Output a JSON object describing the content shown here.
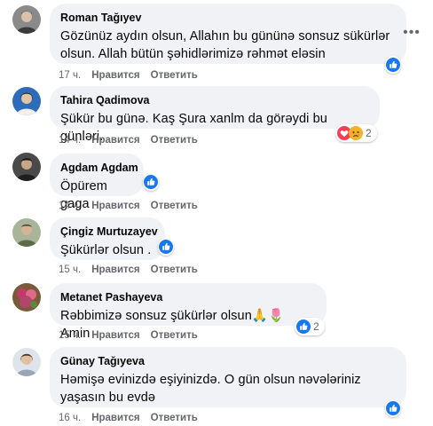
{
  "comments": [
    {
      "author": "Roman Tağıyev",
      "lines": [
        "Gözünüz aydın olsun, Allahın bu gününə sonsuz sükürlər",
        "olsun. Allah bütün şəhidlərimizə rəhmət eləsin"
      ],
      "time": "17 ч.",
      "like_label": "Нравится",
      "reply_label": "Ответить",
      "reactions": [
        "like"
      ],
      "reaction_count": "",
      "avatar_color": "#6b6b6b"
    },
    {
      "author": "Tahira Qadimova",
      "lines": [
        "Şükür bu günə. Kaş Şura xanlm da görəydi bu günləri."
      ],
      "time": "14 ч.",
      "like_label": "Нравится",
      "reply_label": "Ответить",
      "reactions": [
        "love",
        "sad"
      ],
      "reaction_count": "2",
      "avatar_color": "#2d6cb8"
    },
    {
      "author": "Agdam Agdam",
      "lines": [
        "Öpürem gaga"
      ],
      "time": "14 ч.",
      "like_label": "Нравится",
      "reply_label": "Ответить",
      "reactions": [
        "like"
      ],
      "reaction_count": "",
      "avatar_color": "#3b3b3b"
    },
    {
      "author": "Çingiz Murtuzayev",
      "lines": [
        "Şükürlər olsun ."
      ],
      "time": "15 ч.",
      "like_label": "Нравится",
      "reply_label": "Ответить",
      "reactions": [
        "like"
      ],
      "reaction_count": "",
      "avatar_color": "#7a8a6a"
    },
    {
      "author": "Metanet Pashayeva",
      "lines": [
        "Rəbbimizə sonsuz şükürlər olsun🙏🌷 Amin"
      ],
      "time": "15 ч.",
      "like_label": "Нравится",
      "reply_label": "Ответить",
      "reactions": [
        "like"
      ],
      "reaction_count": "2",
      "avatar_color": "#b0466a"
    },
    {
      "author": "Günay Tağıyeva",
      "lines": [
        "Həmişə evinizdə eşiyinizdə. O gün olsun nəvələriniz",
        "yaşasın bu evdə"
      ],
      "time": "16 ч.",
      "like_label": "Нравится",
      "reply_label": "Ответить",
      "reactions": [
        "like"
      ],
      "reaction_count": "",
      "avatar_color": "#9aa6b8"
    }
  ],
  "colors": {
    "bubble_bg": "#f0f2f5",
    "meta_text": "#65676b",
    "like_blue": "#1877f2",
    "love_red": "#f33e58",
    "sad_yellow": "#f7b125"
  },
  "icons": {
    "like": "thumbs-up-icon",
    "love": "heart-icon",
    "sad": "sad-face-icon",
    "more": "more-dots-icon"
  }
}
